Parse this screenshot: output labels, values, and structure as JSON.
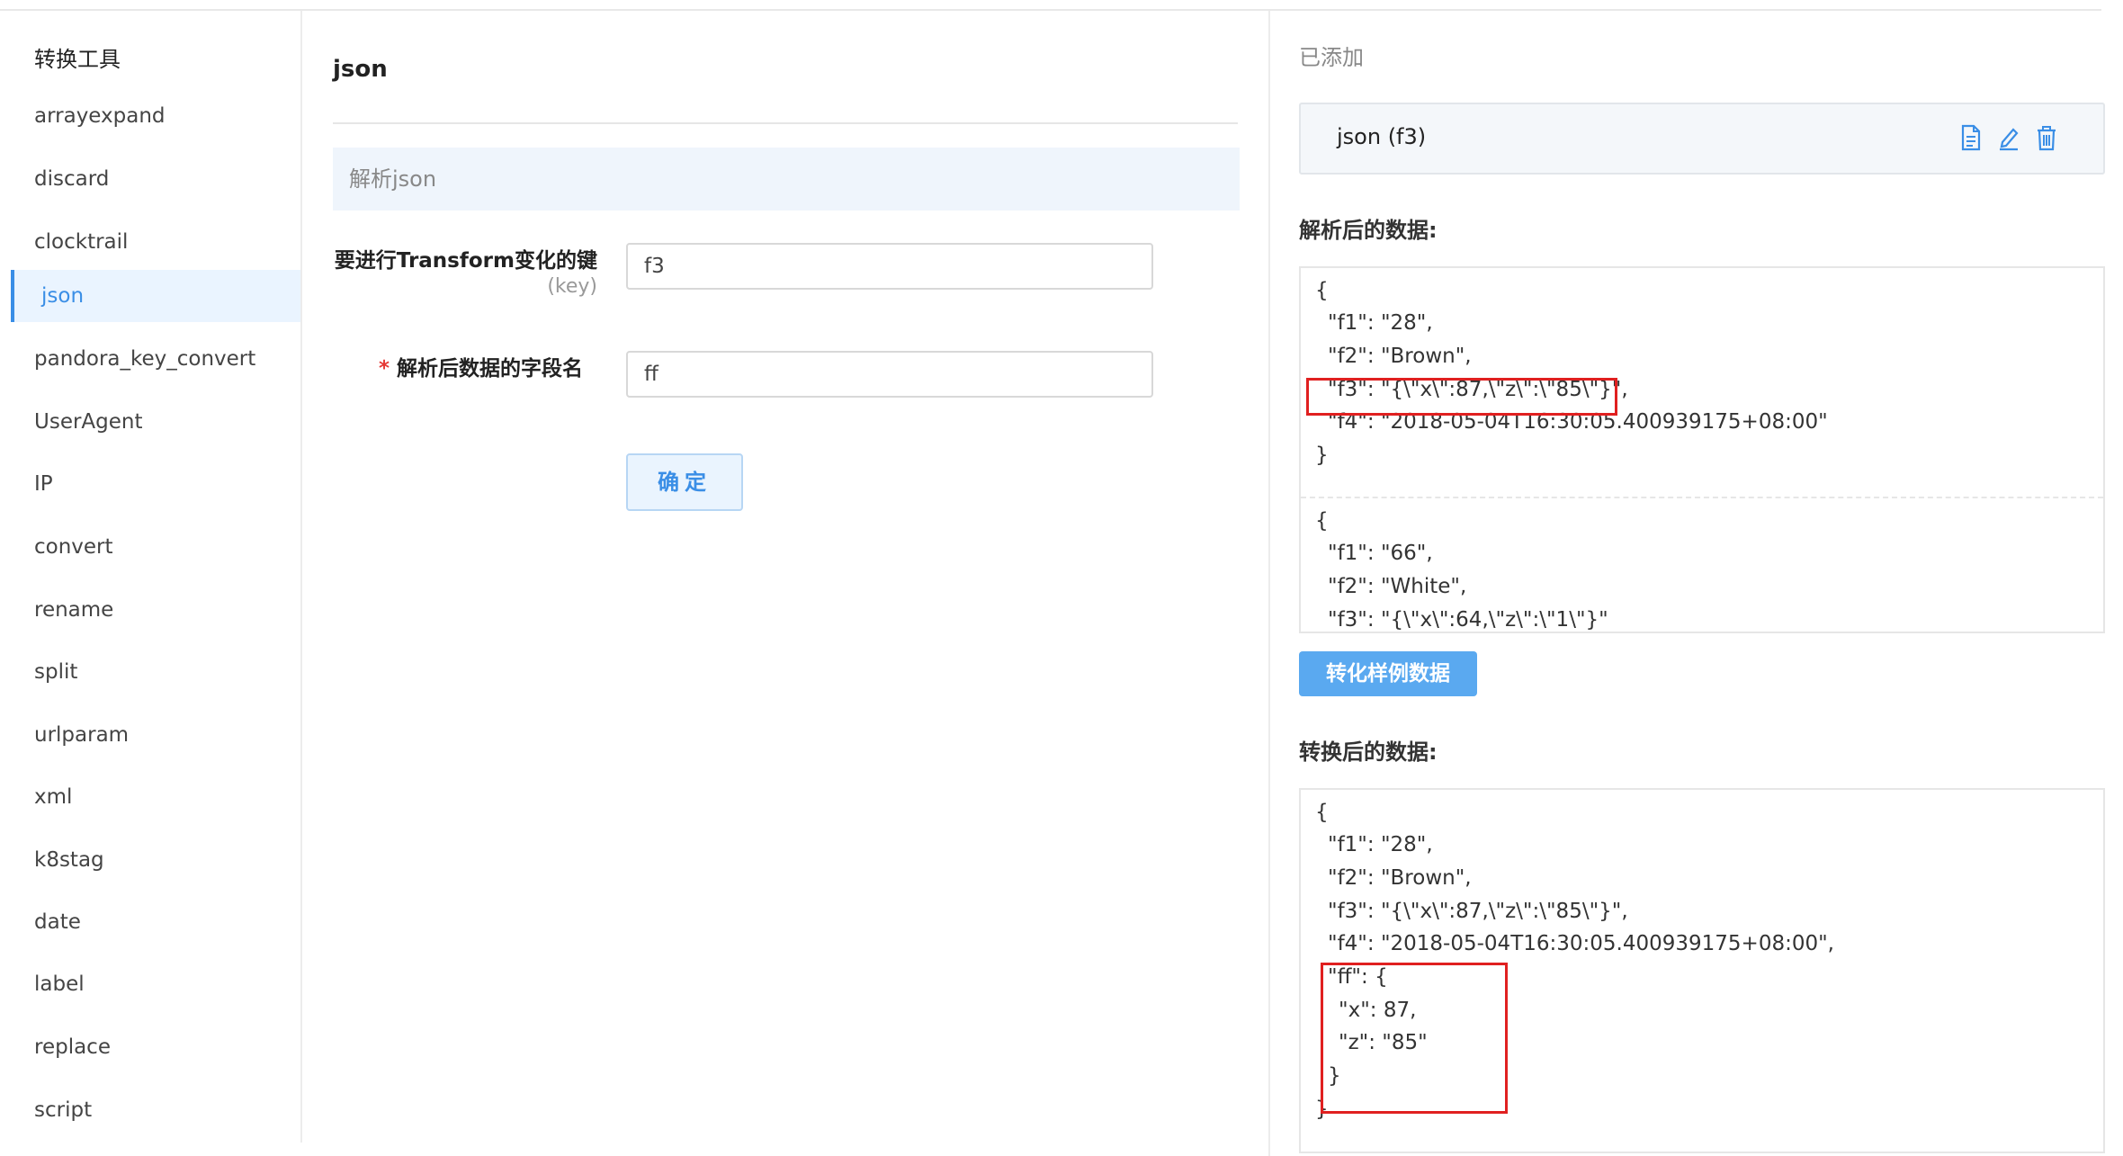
{
  "sidebar": {
    "title": "转换工具",
    "items": [
      {
        "label": "arrayexpand"
      },
      {
        "label": "discard"
      },
      {
        "label": "clocktrail"
      },
      {
        "label": "json"
      },
      {
        "label": "pandora_key_convert"
      },
      {
        "label": "UserAgent"
      },
      {
        "label": "IP"
      },
      {
        "label": "convert"
      },
      {
        "label": "rename"
      },
      {
        "label": "split"
      },
      {
        "label": "urlparam"
      },
      {
        "label": "xml"
      },
      {
        "label": "k8stag"
      },
      {
        "label": "date"
      },
      {
        "label": "label"
      },
      {
        "label": "replace"
      },
      {
        "label": "script"
      }
    ],
    "active": "json"
  },
  "form": {
    "title": "json",
    "banner": "解析json",
    "key_label": "要进行Transform变化的键",
    "key_hint": "(key)",
    "key_value": "f3",
    "field_required": "*",
    "field_label": "解析后数据的字段名",
    "field_value": "ff",
    "confirm_label": "确定"
  },
  "right": {
    "added_label": "已添加",
    "added_item": "json (f3)",
    "icons": [
      "document-icon",
      "edit-icon",
      "trash-icon"
    ],
    "accent_color": "#3a8ee6",
    "parsed_title": "解析后的数据:",
    "parsed_records": [
      [
        "{",
        "\"f1\": \"28\",",
        "\"f2\": \"Brown\",",
        "\"f3\": \"{\\\"x\\\":87,\\\"z\\\":\\\"85\\\"}\",",
        "\"f4\": \"2018-05-04T16:30:05.400939175+08:00\"",
        "}"
      ],
      [
        "{",
        "\"f1\": \"66\",",
        "\"f2\": \"White\",",
        "\"f3\": \"{\\\"x\\\":64,\\\"z\\\":\\\"1\\\"}\""
      ]
    ],
    "convert_button": "转化样例数据",
    "converted_title": "转换后的数据:",
    "converted_lines": [
      "{",
      "\"f1\": \"28\",",
      "\"f2\": \"Brown\",",
      "\"f3\": \"{\\\"x\\\":87,\\\"z\\\":\\\"85\\\"}\",",
      "\"f4\": \"2018-05-04T16:30:05.400939175+08:00\",",
      "\"ff\": {",
      "\"x\": 87,",
      "\"z\": \"85\"",
      "}",
      "}"
    ]
  }
}
